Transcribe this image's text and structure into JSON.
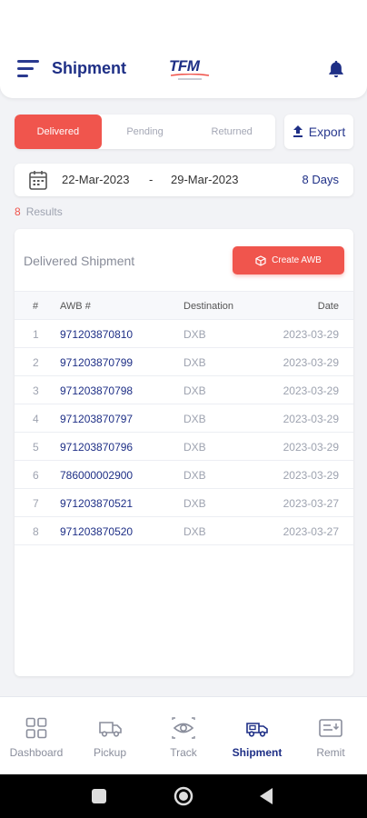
{
  "header": {
    "title": "Shipment",
    "logo_text": "TFM",
    "icons": [
      "menu-icon",
      "logo",
      "bell-icon"
    ]
  },
  "tabs": [
    {
      "label": "Delivered",
      "active": true
    },
    {
      "label": "Pending",
      "active": false
    },
    {
      "label": "Returned",
      "active": false
    }
  ],
  "export": {
    "label": "Export",
    "icon": "upload-icon"
  },
  "date_range": {
    "start": "22-Mar-2023",
    "separator": "-",
    "end": "29-Mar-2023",
    "days": "8 Days",
    "icon": "calendar-icon"
  },
  "results": {
    "count": "8",
    "label": "Results"
  },
  "card": {
    "title": "Delivered Shipment",
    "create_label": "Create AWB",
    "columns": [
      "#",
      "AWB #",
      "Destination",
      "Date"
    ],
    "rows": [
      {
        "num": "1",
        "awb": "971203870810",
        "dest": "DXB",
        "date": "2023-03-29"
      },
      {
        "num": "2",
        "awb": "971203870799",
        "dest": "DXB",
        "date": "2023-03-29"
      },
      {
        "num": "3",
        "awb": "971203870798",
        "dest": "DXB",
        "date": "2023-03-29"
      },
      {
        "num": "4",
        "awb": "971203870797",
        "dest": "DXB",
        "date": "2023-03-29"
      },
      {
        "num": "5",
        "awb": "971203870796",
        "dest": "DXB",
        "date": "2023-03-29"
      },
      {
        "num": "6",
        "awb": "786000002900",
        "dest": "DXB",
        "date": "2023-03-29"
      },
      {
        "num": "7",
        "awb": "971203870521",
        "dest": "DXB",
        "date": "2023-03-27"
      },
      {
        "num": "8",
        "awb": "971203870520",
        "dest": "DXB",
        "date": "2023-03-27"
      }
    ]
  },
  "nav": [
    {
      "label": "Dashboard",
      "icon": "grid-icon",
      "active": false
    },
    {
      "label": "Pickup",
      "icon": "truck-icon",
      "active": false
    },
    {
      "label": "Track",
      "icon": "eye-icon",
      "active": false
    },
    {
      "label": "Shipment",
      "icon": "delivery-truck-icon",
      "active": true
    },
    {
      "label": "Remit",
      "icon": "remit-icon",
      "active": false
    }
  ],
  "colors": {
    "accent": "#f0554d",
    "primary": "#1e2f86",
    "muted": "#9ea3b0"
  }
}
